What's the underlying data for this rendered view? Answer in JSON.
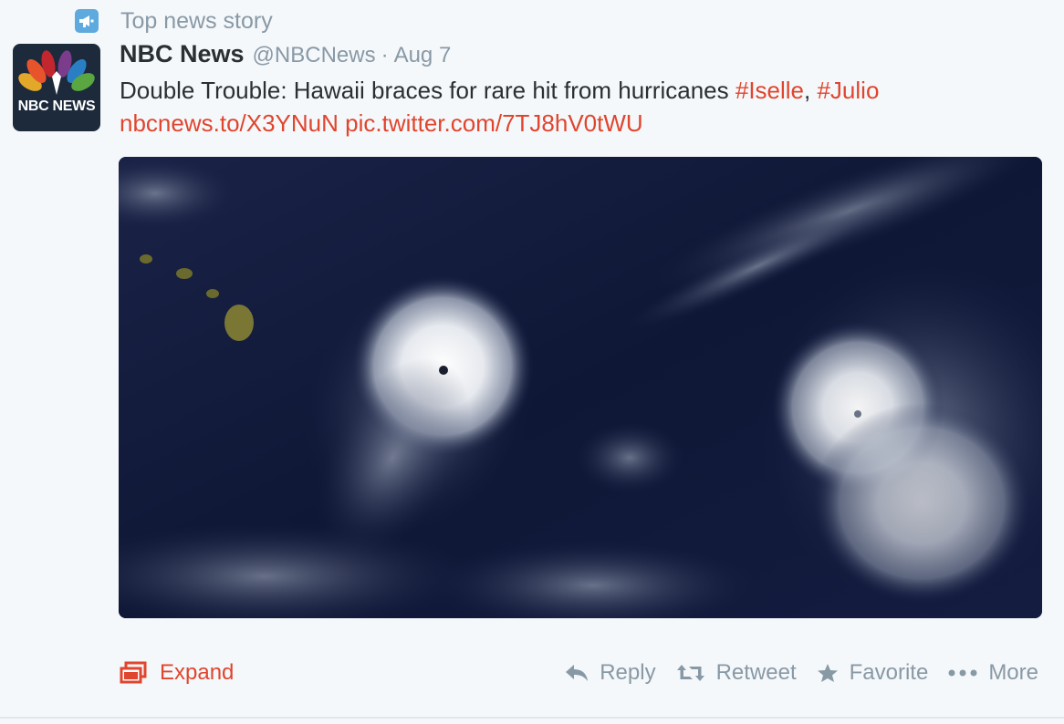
{
  "context": {
    "label": "Top news story",
    "icon": "megaphone-icon"
  },
  "author": {
    "avatar_text": "NBC NEWS",
    "fullname": "NBC News",
    "username": "@NBCNews",
    "separator": "·",
    "time": "Aug 7"
  },
  "tweet": {
    "text_prefix": "Double Trouble: Hawaii braces for rare hit from hurricanes ",
    "hashtag1": "#Iselle",
    "comma": ", ",
    "hashtag2": "#Julio",
    "link1": "nbcnews.to/X3YNuN",
    "link2": "pic.twitter.com/7TJ8hV0tWU"
  },
  "media": {
    "icon": "satellite-image"
  },
  "footer": {
    "expand_label": "Expand",
    "reply_label": "Reply",
    "retweet_label": "Retweet",
    "favorite_label": "Favorite",
    "more_label": "More"
  },
  "colors": {
    "accent": "#e0452e",
    "muted": "#8899a6",
    "text": "#292f33",
    "background": "#f5f8fa",
    "context_icon": "#5ea9dd"
  }
}
